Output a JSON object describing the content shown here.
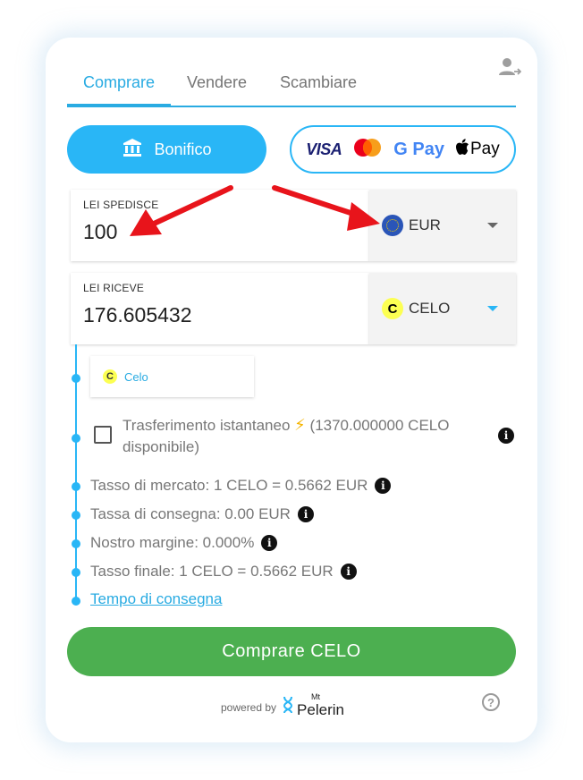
{
  "tabs": [
    {
      "label": "Comprare",
      "active": true
    },
    {
      "label": "Vendere",
      "active": false
    },
    {
      "label": "Scambiare",
      "active": false
    }
  ],
  "payment": {
    "bank_label": "Bonifico",
    "card_brands": [
      "VISA",
      "G Pay",
      "Pay"
    ]
  },
  "send": {
    "label": "LEI SPEDISCE",
    "value": "100",
    "currency": "EUR"
  },
  "receive": {
    "label": "LEI RICEVE",
    "value": "176.605432",
    "currency": "CELO"
  },
  "network": {
    "logo_letter": "C",
    "name": "Celo"
  },
  "instant": {
    "text": "Trasferimento istantaneo",
    "availability": "(1370.000000 CELO disponibile)",
    "checked": false
  },
  "rates": {
    "market": "Tasso di mercato: 1 CELO = 0.5662 EUR",
    "delivery_fee": "Tassa di consegna: 0.00 EUR",
    "margin": "Nostro margine: 0.000%",
    "final": "Tasso finale: 1 CELO = 0.5662 EUR"
  },
  "delivery_time_link": "Tempo di consegna",
  "buy_button": "Comprare CELO",
  "footer": {
    "powered_by": "powered by",
    "brand_prefix": "Mt",
    "brand_name": "Pelerin",
    "help": "?"
  },
  "info_glyph": "i",
  "colors": {
    "accent": "#29b6f6",
    "buy_green": "#4caf50",
    "annotation_arrow": "#e8141b"
  },
  "icons": [
    "account-switch-icon",
    "bank-icon",
    "mastercard-icon",
    "apple-icon",
    "eu-flag-icon",
    "celo-logo-icon",
    "lightning-icon",
    "info-icon",
    "pelerin-logo-icon",
    "help-icon"
  ]
}
